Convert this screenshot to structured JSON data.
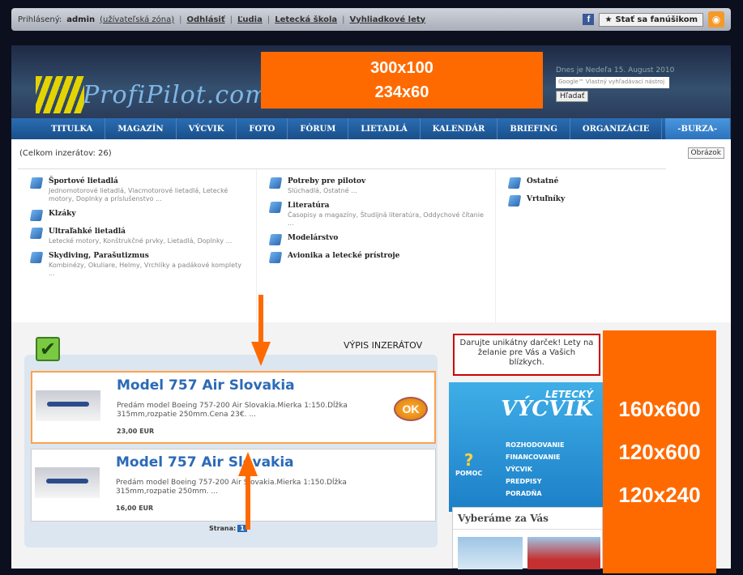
{
  "topbar": {
    "logged_prefix": "Prihlásený:",
    "user": "admin",
    "user_zone": "(užívateľská zóna)",
    "logout": "Odhlásiť",
    "people": "Ľudia",
    "school": "Letecká škola",
    "flights": "Vyhliadkové lety",
    "fan_label": "Stať sa fanúšikom"
  },
  "header": {
    "logo_text": "ProfiPilot.com",
    "ad_line1": "300x100",
    "ad_line2": "234x60",
    "date": "Dnes je Nedeľa 15. August 2010",
    "search_placeholder": "Google™ Vlastný vyhľadávací nástroj",
    "search_button": "Hľadať"
  },
  "nav": [
    "TITULKA",
    "MAGAZÍN",
    "VÝCVIK",
    "FOTO",
    "FÓRUM",
    "LIETADLÁ",
    "KALENDÁR",
    "BRIEFING",
    "ORGANIZÁCIE",
    "-BURZA-"
  ],
  "main": {
    "count": "(Celkom inzerátov: 26)",
    "image_button": "Obrázok",
    "categories": {
      "col1": [
        {
          "title": "Športové lietadlá",
          "sub": "Jednomotorové lietadlá, Viacmotorové lietadlá, Letecké motory, Doplnky a príslušenstvo ..."
        },
        {
          "title": "Klzáky",
          "sub": ""
        },
        {
          "title": "Ultraľahké lietadlá",
          "sub": "Letecké motory, Konštrukčné prvky, Lietadlá, Doplnky ..."
        },
        {
          "title": "Skydiving, Parašutizmus",
          "sub": "Kombinézy, Okuliare, Helmy, Vrchlíky a padákové komplety ..."
        }
      ],
      "col2": [
        {
          "title": "Potreby pre pilotov",
          "sub": "Slúchadlá, Ostatné ..."
        },
        {
          "title": "Literatúra",
          "sub": "Časopisy a magazíny, Študijná literatúra, Oddychové čítanie ..."
        },
        {
          "title": "Modelárstvo",
          "sub": ""
        },
        {
          "title": "Avionika a letecké prístroje",
          "sub": ""
        }
      ],
      "col3": [
        {
          "title": "Ostatné",
          "sub": ""
        },
        {
          "title": "Vrtuľníky",
          "sub": ""
        }
      ]
    },
    "list_title": "VÝPIS INZERÁTOV",
    "ads": [
      {
        "title": "Model 757 Air Slovakia",
        "desc": "Predám model Boeing 757-200 Air Slovakia.Mierka 1:150.Dĺžka 315mm,rozpatie 250mm.Cena 23€. ...",
        "price": "23,00 EUR"
      },
      {
        "title": "Model 757 Air Slovakia",
        "desc": "Predám model Boeing 757-200 Air Slovakia.Mierka 1:150.Dĺžka 315mm,rozpatie 250mm. ...",
        "price": "16,00 EUR"
      }
    ],
    "ok_label": "OK",
    "pager_label": "Strana:",
    "pager_page": "1"
  },
  "sidebar": {
    "promo": "Darujte unikátny darček! Lety na želanie pre Vás a Vašich blízkych.",
    "vycvik_small": "LETECKÝ",
    "vycvik_big": "VÝCVIK",
    "pomoc": "POMOC",
    "menu": [
      "ROZHODOVANIE",
      "FINANCOVANIE",
      "VÝCVIK",
      "PREDPISY",
      "PORADŇA"
    ],
    "vyber_title": "Vyberáme za Vás",
    "sky_ads": [
      "160x600",
      "120x600",
      "120x240"
    ]
  },
  "colors": {
    "accent": "#ff6a00",
    "nav": "#1a4f8a",
    "link": "#2b6ab7"
  }
}
